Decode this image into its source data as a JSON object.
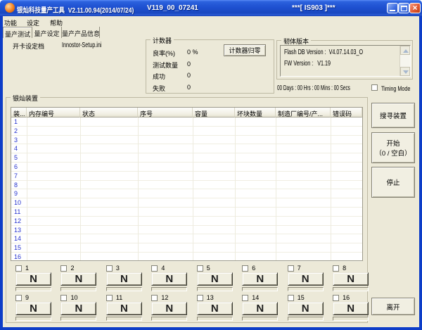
{
  "window": {
    "title_left": "银灿科技量产工具  V2.11.00.94(2014/07/24)",
    "title_mid": "V119_00_07241",
    "title_right": "***[ IS903 ]***"
  },
  "menu": {
    "items": [
      "功能",
      "设定",
      "帮助"
    ]
  },
  "tabs": [
    "量产测试",
    "量产设定",
    "量产产品信息"
  ],
  "config": {
    "label": "开卡设定档",
    "value": "Innostor-Setup.ini"
  },
  "counter": {
    "title": "计数器",
    "reset_button": "计数器归零",
    "rows": [
      {
        "label": "良率(%)",
        "value": "0 %"
      },
      {
        "label": "测试数量",
        "value": "0"
      },
      {
        "label": "成功",
        "value": "0"
      },
      {
        "label": "失败",
        "value": "0"
      }
    ]
  },
  "firmware": {
    "title": "韧体版本",
    "lines": [
      "Flash DB Version :  V4.07.14.03_O",
      "FW Version :   V1.19"
    ]
  },
  "timer": {
    "text": "00 Days : 00 Hrs : 00 Mins : 00 Secs",
    "timing_mode": "Timing Mode"
  },
  "devices": {
    "title": "银灿装置",
    "columns": [
      "装...",
      "内存编号",
      "状态",
      "序号",
      "容量",
      "坏块数量",
      "制造厂编号/产...",
      "错误码"
    ],
    "rows": [
      "1",
      "2",
      "3",
      "4",
      "5",
      "6",
      "7",
      "8",
      "9",
      "10",
      "11",
      "12",
      "13",
      "14",
      "15",
      "16"
    ]
  },
  "slots": {
    "labels": [
      "1",
      "2",
      "3",
      "4",
      "5",
      "6",
      "7",
      "8",
      "9",
      "10",
      "11",
      "12",
      "13",
      "14",
      "15",
      "16"
    ],
    "button_text": "N"
  },
  "actions": {
    "search": "搜寻装置",
    "start_line1": "开始",
    "start_line2": "（0 / 空白）",
    "stop": "停止",
    "exit": "离开"
  }
}
